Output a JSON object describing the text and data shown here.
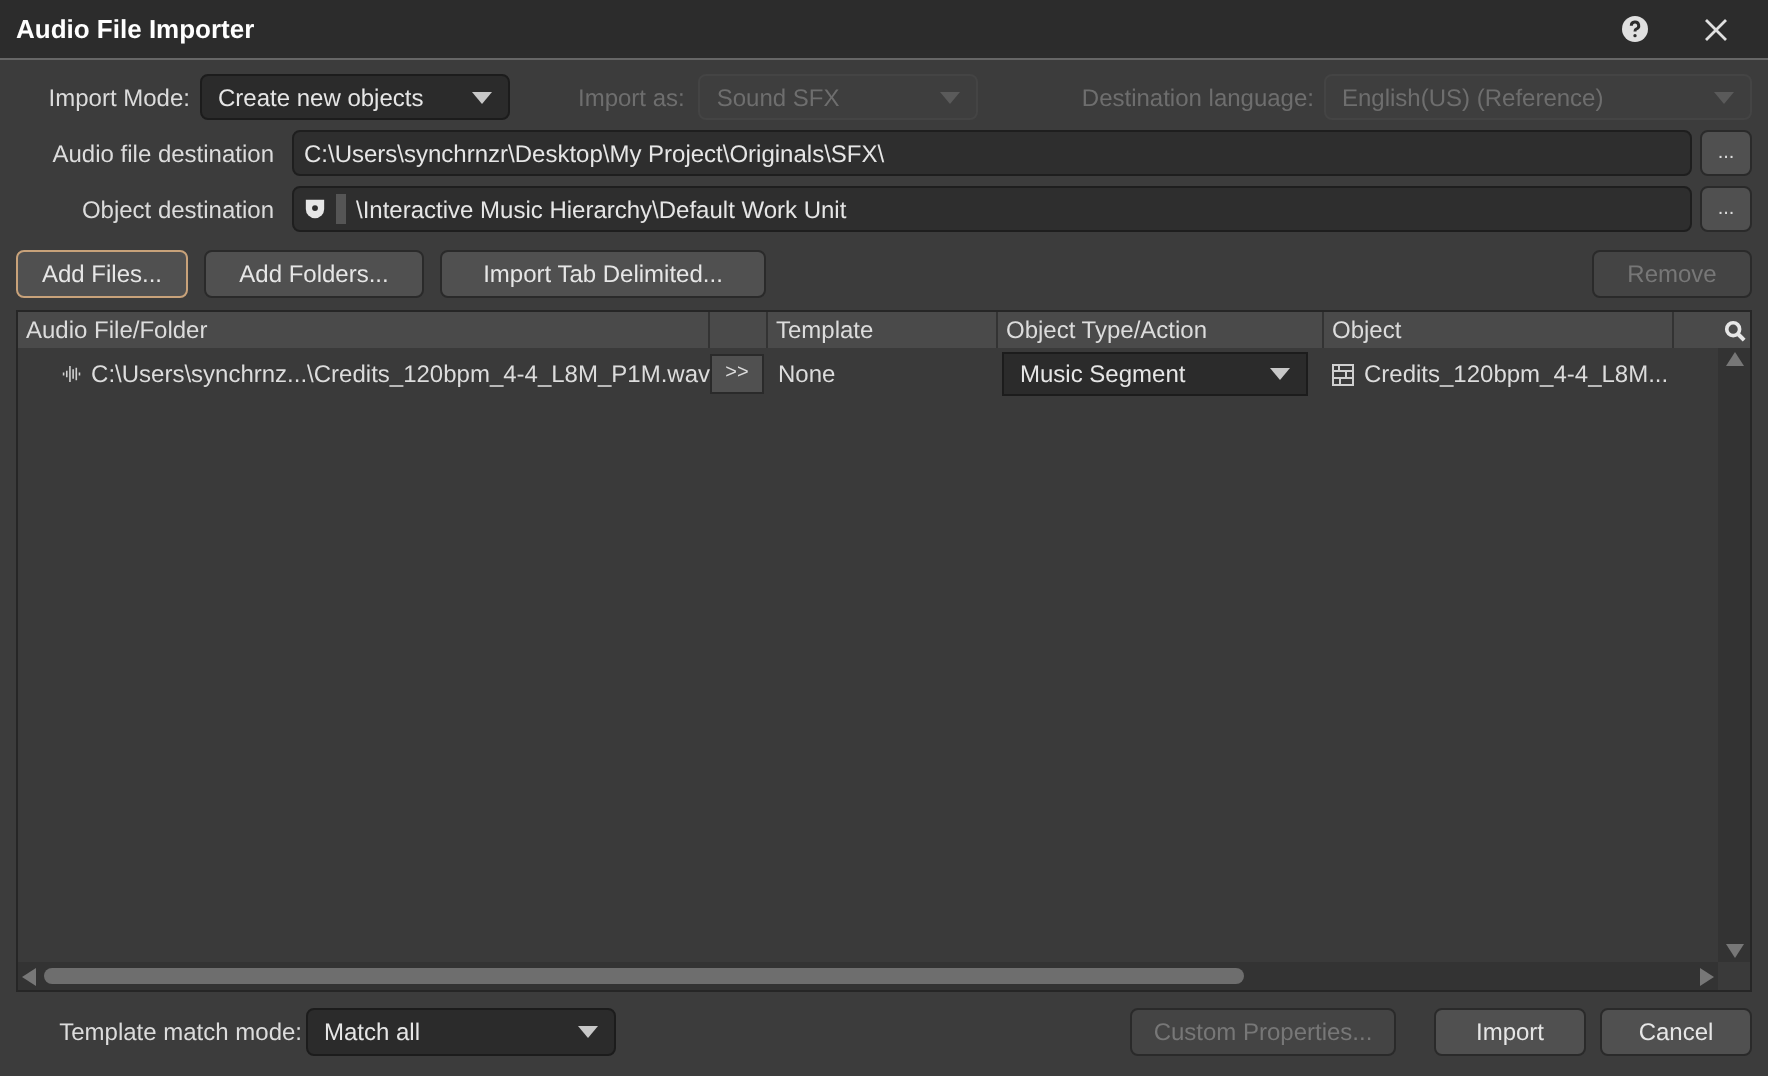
{
  "window": {
    "title": "Audio File Importer"
  },
  "import_mode": {
    "label": "Import Mode:",
    "value": "Create new objects",
    "disabled": false
  },
  "import_as": {
    "label": "Import as:",
    "value": "Sound SFX",
    "disabled": true
  },
  "destination_language": {
    "label": "Destination language:",
    "value": "English(US) (Reference)",
    "disabled": true
  },
  "paths": [
    {
      "label": "Audio file destination",
      "value": "C:\\Users\\synchrnzr\\Desktop\\My Project\\Originals\\SFX\\",
      "kind": "folder",
      "browse": "..."
    },
    {
      "label": "Object destination",
      "value": "\\Interactive Music Hierarchy\\Default Work Unit",
      "kind": "object",
      "browse": "..."
    }
  ],
  "buttons": [
    {
      "label": "Add Files...",
      "focused": true,
      "disabled": false
    },
    {
      "label": "Add Folders...",
      "focused": false,
      "disabled": false
    },
    {
      "label": "Import Tab Delimited...",
      "focused": false,
      "disabled": false
    }
  ],
  "remove_button": {
    "label": "Remove",
    "disabled": true
  },
  "table": {
    "columns": [
      "Audio File/Folder",
      "Template",
      "Object Type/Action",
      "Object"
    ],
    "rows": [
      {
        "file": "C:\\Users\\synchrnz...\\Credits_120bpm_4-4_L8M_P1M.wav",
        "arrow": ">>",
        "template": "None",
        "action": "Music Segment",
        "object": "Credits_120bpm_4-4_L8M..."
      }
    ]
  },
  "template_match_mode": {
    "label": "Template match mode:",
    "value": "Match all"
  },
  "footer_buttons": [
    {
      "label": "Custom Properties...",
      "disabled": true
    },
    {
      "label": "Import",
      "disabled": false
    },
    {
      "label": "Cancel",
      "disabled": false
    }
  ]
}
